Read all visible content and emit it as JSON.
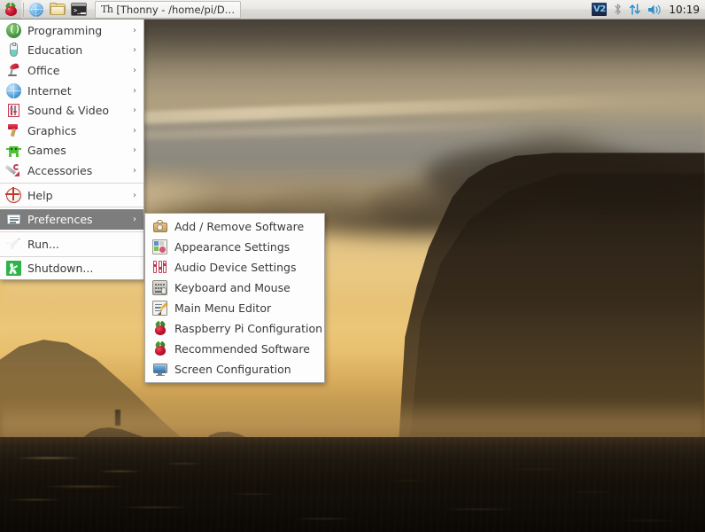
{
  "panel": {
    "launchers": [
      {
        "name": "raspberry-menu-button",
        "icon": "raspberry-icon",
        "label": "Menu"
      },
      {
        "name": "web-browser-launcher",
        "icon": "globe-icon",
        "label": "Web Browser"
      },
      {
        "name": "file-manager-launcher",
        "icon": "folder-icon",
        "label": "File Manager"
      },
      {
        "name": "terminal-launcher",
        "icon": "terminal-icon",
        "label": "Terminal"
      }
    ],
    "task_button": {
      "icon_text": "Th",
      "title": "[Thonny  -  /home/pi/D…"
    },
    "tray": {
      "vnc_badge": "V2",
      "bluetooth": "bluetooth-icon",
      "network": "network-updown-icon",
      "volume": "volume-icon",
      "clock": "10:19"
    }
  },
  "main_menu": {
    "items": [
      {
        "label": "Programming",
        "icon": "programming-icon",
        "arrow": "›",
        "selected": false,
        "separator_after": false
      },
      {
        "label": "Education",
        "icon": "education-icon",
        "arrow": "›",
        "selected": false,
        "separator_after": false
      },
      {
        "label": "Office",
        "icon": "office-icon",
        "arrow": "›",
        "selected": false,
        "separator_after": false
      },
      {
        "label": "Internet",
        "icon": "internet-icon",
        "arrow": "›",
        "selected": false,
        "separator_after": false
      },
      {
        "label": "Sound & Video",
        "icon": "sound-video-icon",
        "arrow": "›",
        "selected": false,
        "separator_after": false
      },
      {
        "label": "Graphics",
        "icon": "graphics-icon",
        "arrow": "›",
        "selected": false,
        "separator_after": false
      },
      {
        "label": "Games",
        "icon": "games-icon",
        "arrow": "›",
        "selected": false,
        "separator_after": false
      },
      {
        "label": "Accessories",
        "icon": "accessories-icon",
        "arrow": "›",
        "selected": false,
        "separator_after": true
      },
      {
        "label": "Help",
        "icon": "help-icon",
        "arrow": "›",
        "selected": false,
        "separator_after": true
      },
      {
        "label": "Preferences",
        "icon": "preferences-icon",
        "arrow": "›",
        "selected": true,
        "separator_after": true
      },
      {
        "label": "Run...",
        "icon": "run-icon",
        "arrow": "",
        "selected": false,
        "separator_after": true
      },
      {
        "label": "Shutdown...",
        "icon": "shutdown-icon",
        "arrow": "",
        "selected": false,
        "separator_after": false
      }
    ]
  },
  "preferences_submenu": {
    "items": [
      {
        "label": "Add / Remove Software",
        "icon": "add-remove-software-icon"
      },
      {
        "label": "Appearance Settings",
        "icon": "appearance-settings-icon"
      },
      {
        "label": "Audio Device Settings",
        "icon": "audio-device-settings-icon"
      },
      {
        "label": "Keyboard and Mouse",
        "icon": "keyboard-mouse-icon"
      },
      {
        "label": "Main Menu Editor",
        "icon": "main-menu-editor-icon"
      },
      {
        "label": "Raspberry Pi Configuration",
        "icon": "raspberry-pi-config-icon"
      },
      {
        "label": "Recommended Software",
        "icon": "recommended-software-icon"
      },
      {
        "label": "Screen Configuration",
        "icon": "screen-configuration-icon"
      }
    ]
  },
  "desktop": {
    "wallpaper_description": "Sunset seascape with golden sky, dark clouds and silhouetted headland over dark sea",
    "colors": {
      "sky_gold": "#e0b969",
      "cloud_dark": "#3c362e",
      "sea_dark": "#120e08",
      "panel_bg": "#eae8e5",
      "menu_highlight": "#7d7d7d"
    }
  }
}
